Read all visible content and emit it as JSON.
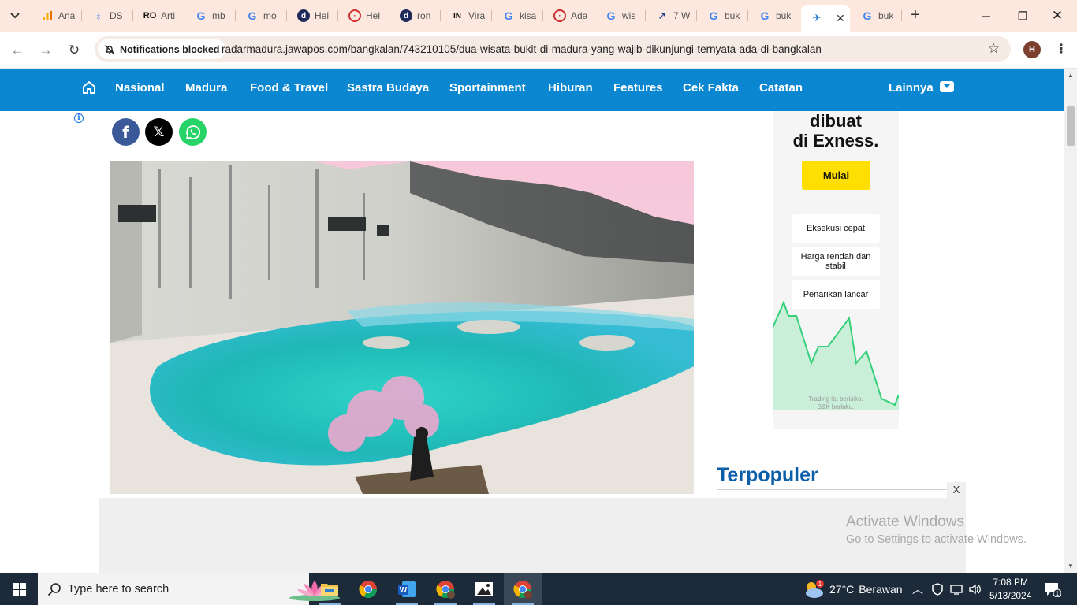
{
  "browser": {
    "tabs": [
      {
        "title": "Ana",
        "icon": "analytics-icon"
      },
      {
        "title": "DS",
        "icon": "ds-icon"
      },
      {
        "title": "Arti",
        "icon": "article-site-icon"
      },
      {
        "title": "mb",
        "icon": "google-icon"
      },
      {
        "title": "mo",
        "icon": "google-icon"
      },
      {
        "title": "Hel",
        "icon": "detik-icon"
      },
      {
        "title": "Hel",
        "icon": "red-site-icon"
      },
      {
        "title": "ron",
        "icon": "detik-icon"
      },
      {
        "title": "Vira",
        "icon": "in-site-icon"
      },
      {
        "title": "kisa",
        "icon": "google-icon"
      },
      {
        "title": "Ada",
        "icon": "red-site-icon"
      },
      {
        "title": "wis",
        "icon": "google-icon"
      },
      {
        "title": "7 W",
        "icon": "arrow-site-icon"
      },
      {
        "title": "buk",
        "icon": "google-icon"
      },
      {
        "title": "buk",
        "icon": "google-icon"
      },
      {
        "title": "",
        "icon": "radar-site-icon",
        "active": true
      },
      {
        "title": "buk",
        "icon": "google-icon"
      }
    ],
    "notif_chip": "Notifications blocked",
    "url": "radarmadura.jawapos.com/bangkalan/743210105/dua-wisata-bukit-di-madura-yang-wajib-dikunjungi-ternyata-ada-di-bangkalan",
    "profile_initial": "H"
  },
  "site_nav": {
    "items": [
      "Nasional",
      "Madura",
      "Food & Travel",
      "Sastra Budaya",
      "Sportainment",
      "Hiburan",
      "Features",
      "Cek Fakta",
      "Catatan"
    ],
    "more_label": "Lainnya"
  },
  "share": {
    "x_label": "𝕏"
  },
  "ad": {
    "headline_1": "dibuat",
    "headline_2": "di Exness.",
    "cta": "Mulai",
    "features": [
      "Eksekusi cepat",
      "Harga rendah dan stabil",
      "Penarikan lancar"
    ],
    "risk_1": "Trading itu berisiko.",
    "risk_2": "S&K berlaku."
  },
  "sidebar": {
    "popular_title": "Terpopuler"
  },
  "sticky_ad": {
    "close_label": "X"
  },
  "watermark": {
    "line1": "Activate Windows",
    "line2": "Go to Settings to activate Windows."
  },
  "taskbar": {
    "search_placeholder": "Type here to search",
    "weather_temp": "27°C",
    "weather_text": "Berawan",
    "weather_badge": "1",
    "time": "7:08 PM",
    "date": "5/13/2024",
    "notification_count": "1"
  },
  "colors": {
    "nav_blue": "#0a87d0",
    "popular_blue": "#0b5ea8",
    "ad_yellow": "#ffde02",
    "tab_strip": "#fce8de"
  }
}
